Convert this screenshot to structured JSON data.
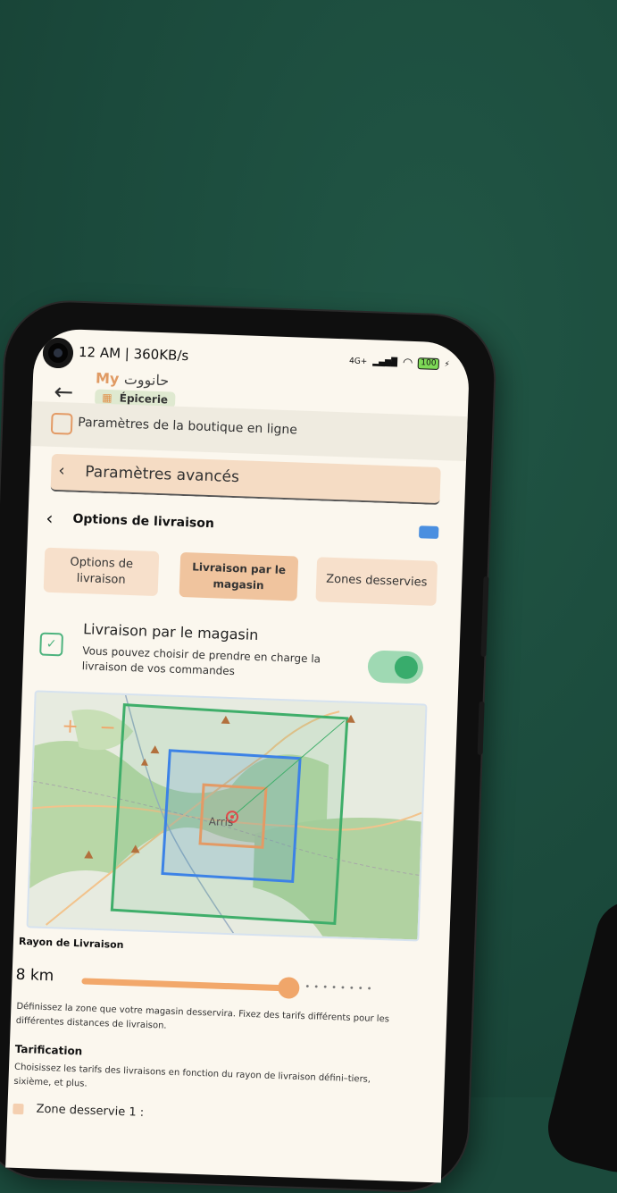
{
  "status_bar": {
    "time": "12 AM | 360KB/s",
    "network": "4G+",
    "battery": "100"
  },
  "header": {
    "logo_prefix": "My",
    "logo_arabic": "حانووت",
    "category": "Épicerie"
  },
  "section": {
    "title": "Paramètres de la boutique en ligne"
  },
  "advanced": {
    "title": "Paramètres avancés"
  },
  "delivery_options": {
    "title": "Options de livraison"
  },
  "tabs": [
    {
      "label": "Options de livraison",
      "active": false
    },
    {
      "label": "Livraison par le magasin",
      "active": true
    },
    {
      "label": "Zones desservies",
      "active": false
    }
  ],
  "store_delivery": {
    "title": "Livraison par le magasin",
    "description": "Vous pouvez choisir de prendre en charge la livraison de vos commandes",
    "enabled": true
  },
  "map": {
    "zoom_in": "+",
    "zoom_out": "−",
    "city_label": "Arris"
  },
  "radius": {
    "label": "Rayon de Livraison",
    "value": "8 km",
    "slider_fraction": 0.68,
    "help": "Définissez la zone que votre magasin desservira. Fixez des tarifs différents pour les différentes distances de livraison."
  },
  "pricing": {
    "title": "Tarification",
    "help": "Choisissez les tarifs des livraisons en fonction du rayon de livraison défini–tiers, sixième, et plus."
  },
  "zones": [
    {
      "label": "Zone desservie 1 :"
    }
  ],
  "colors": {
    "background": "#1b4a3c",
    "accent": "#f0a66a",
    "toggle_on": "#38ac6c",
    "zone_outer": "#3fae6a",
    "zone_middle": "#3c82e6",
    "zone_inner": "#e39a65"
  }
}
